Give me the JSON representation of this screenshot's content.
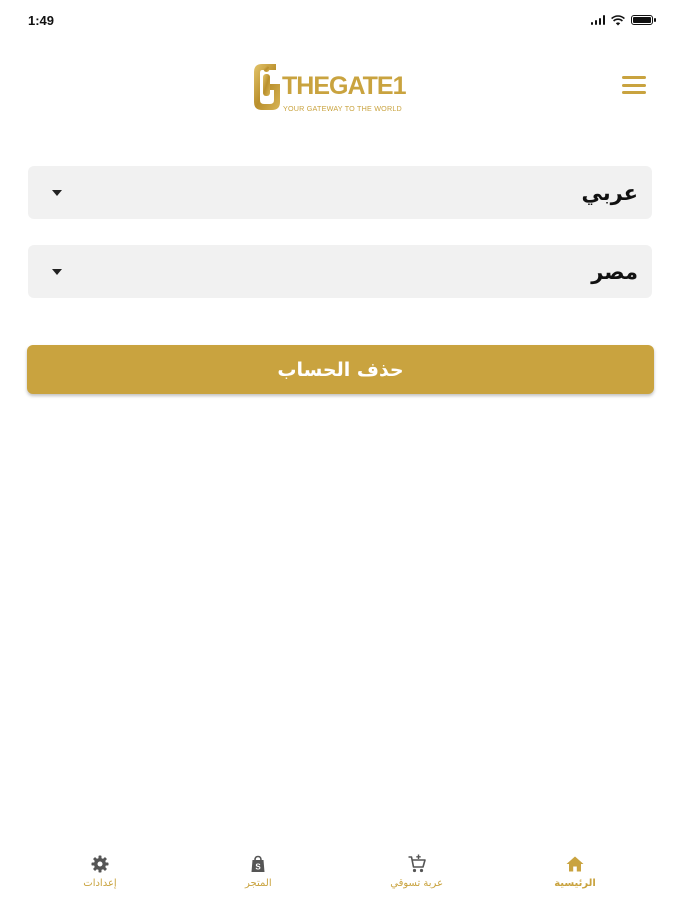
{
  "status_bar": {
    "time": "1:49"
  },
  "header": {
    "logo_text": "THEGATE1",
    "logo_tagline": "YOUR GATEWAY TO THE WORLD",
    "menu_icon": "hamburger-menu-icon"
  },
  "form": {
    "language_value": "عربي",
    "country_value": "مصر",
    "delete_account_label": "حذف الحساب"
  },
  "tabs": [
    {
      "label": "إعدادات",
      "icon": "gear-icon"
    },
    {
      "label": "المتجر",
      "icon": "shopping-bag-icon"
    },
    {
      "label": "عربة تسوقي",
      "icon": "cart-icon"
    },
    {
      "label": "الرئيسية",
      "icon": "home-icon",
      "active": true
    }
  ],
  "colors": {
    "accent": "#c9a33f",
    "field_background": "#f1f1f1",
    "text": "#111111"
  }
}
